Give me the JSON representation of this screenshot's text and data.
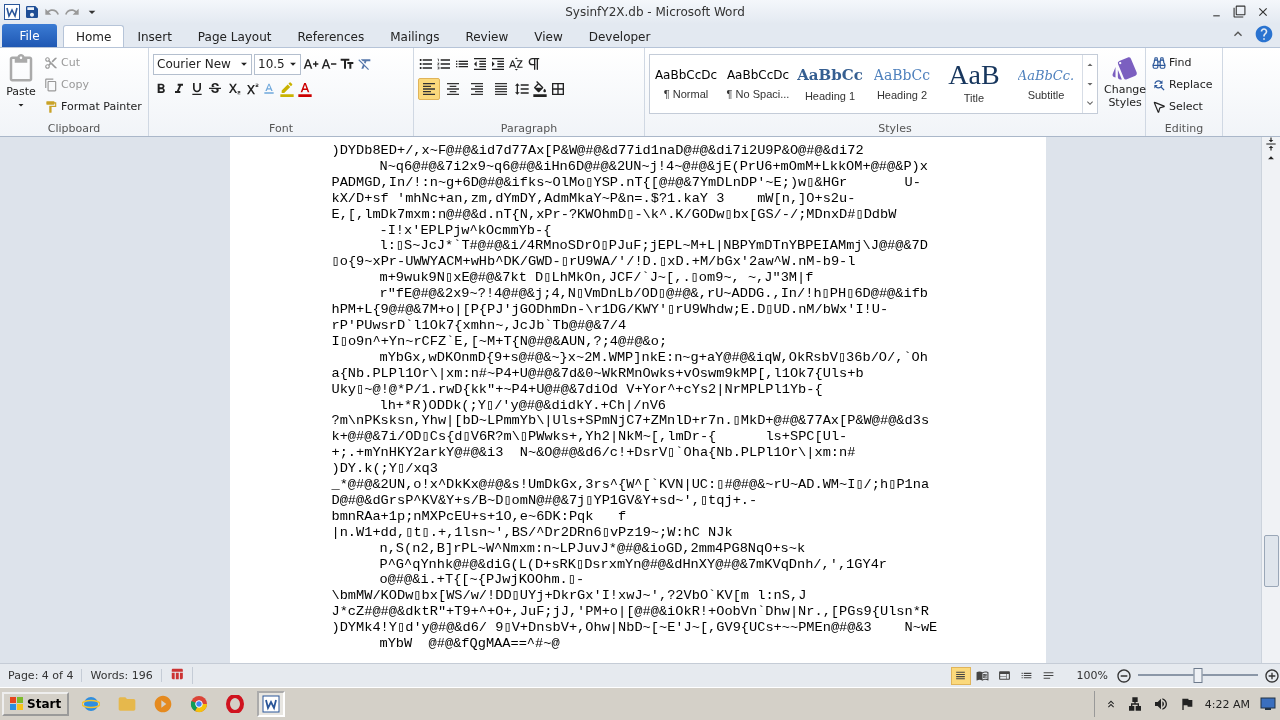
{
  "window": {
    "title": "SysinfY2X.db - Microsoft Word"
  },
  "file_tab": {
    "label": "File"
  },
  "tabs": [
    {
      "label": "Home",
      "selected": true
    },
    {
      "label": "Insert",
      "selected": false
    },
    {
      "label": "Page Layout",
      "selected": false
    },
    {
      "label": "References",
      "selected": false
    },
    {
      "label": "Mailings",
      "selected": false
    },
    {
      "label": "Review",
      "selected": false
    },
    {
      "label": "View",
      "selected": false
    },
    {
      "label": "Developer",
      "selected": false
    }
  ],
  "clipboard": {
    "label": "Clipboard",
    "paste": "Paste",
    "cut": {
      "label": "Cut",
      "disabled": true
    },
    "copy": {
      "label": "Copy",
      "disabled": true
    },
    "format_painter": "Format Painter"
  },
  "font": {
    "label": "Font",
    "font_name": "Courier New",
    "font_size": "10.5"
  },
  "paragraph": {
    "label": "Paragraph",
    "alignments": [
      {
        "kind": "left",
        "selected": true
      },
      {
        "kind": "center",
        "selected": false
      },
      {
        "kind": "right",
        "selected": false
      },
      {
        "kind": "justify",
        "selected": false
      }
    ]
  },
  "styles": {
    "label": "Styles",
    "items": [
      {
        "preview": "AaBbCcDc",
        "label": "¶ Normal",
        "kind": "normal"
      },
      {
        "preview": "AaBbCcDc",
        "label": "¶ No Spaci...",
        "kind": "normal"
      },
      {
        "preview": "AaBbCc",
        "label": "Heading 1",
        "kind": "heading1"
      },
      {
        "preview": "AaBbCc",
        "label": "Heading 2",
        "kind": "heading2"
      },
      {
        "preview": "AaB",
        "label": "Title",
        "kind": "title"
      },
      {
        "preview": "AaBbCc.",
        "label": "Subtitle",
        "kind": "subtitle"
      }
    ],
    "change_styles": [
      "Change",
      "Styles"
    ]
  },
  "editing": {
    "label": "Editing",
    "find": "Find",
    "replace": "Replace",
    "select": "Select"
  },
  "document": {
    "lines": [
      {
        "text": ")DYDb8ED+/,x~F@#@&id7d77Ax[P&W@#@&d77id1naD@#@&di7i2U9P&O@#@&di72",
        "indent": false
      },
      {
        "text": "N~q6@#@&7i2x9~q6@#@&iHn6D@#@&2UN~j!4~@#@&jE(PrU6+mOmM+LkkOM+@#@&P)x",
        "indent": true
      },
      {
        "text": "PADMGD,In/!:n~g+6D@#@&ifks~OlMo▯YSP.nT{[@#@&7YmDLnDP'~E;)w▯&HGr       U-",
        "indent": false
      },
      {
        "text": "kX/D+sf 'mhNc+an,zm,dYmDY,AdmMkaY~P&n=.$?1.kaY 3    mW[n,]O+s2u-",
        "indent": false
      },
      {
        "text": "E,[,lmDk7mxm:n@#@&d.nT{N,xPr-?KWOhmD▯-\\k^.K/GODw▯bx[GS/-/;MDnxD#▯DdbW",
        "indent": false
      },
      {
        "text": "-I!x'EPLPjw^kOcmmYb-{",
        "indent": true
      },
      {
        "text": "l:▯S~JcJ*`T#@#@&i/4RMnoSDrO▯PJuF;jEPL~M+L|NBPYmDTnYBPEIAMmj\\J@#@&7D",
        "indent": true
      },
      {
        "text": "▯o{9~xPr-UWWYACM+wHb^DK/GWD-▯rU9WA/'/!D.▯xD.+M/bGx'2aw^W.nM-b9-l",
        "indent": false
      },
      {
        "text": "m+9wuk9N▯xE@#@&7kt D▯LhMkOn,JCF/`J~[,.▯om9~, ~,J\"3M|f",
        "indent": true
      },
      {
        "text": "r\"fE@#@&2x9~?!4@#@&j;4,N▯VmDnLb/OD▯@#@&,rU~ADDG.,In/!h▯PH▯6D@#@&ifb",
        "indent": true
      },
      {
        "text": "hPM+L{9@#@&7M+o|[P{PJ'jGODhmDn-\\r1DG/KWY'▯rU9Whdw;E.D▯UD.nM/bWx'I!U-",
        "indent": false
      },
      {
        "text": "rP'PUwsrD`l1Ok7{xmhn~,JcJb`Tb@#@&7/4",
        "indent": false
      },
      {
        "text": "I▯o9n^+Yn~rCFZ`E,[~M+T{N@#@&AUN,?;4@#@&o;",
        "indent": false
      },
      {
        "text": "mYbGx,wDKOnmD{9+s@#@&~}x~2M.WMP]nkE:n~g+aY@#@&iqW,OkRsbV▯36b/O/,`Oh",
        "indent": true
      },
      {
        "text": "a{Nb.PLPl1Or\\|xm:n#~P4+U@#@&7d&0~WkRMnOwks+vOswm9kMP[,l1Ok7{Uls+b",
        "indent": false
      },
      {
        "text": "Uky▯~@!@*P/1.rwD{kk\"+~P4+U@#@&7diOd V+Yor^+cYs2|NrMPLPl1Yb-{",
        "indent": false
      },
      {
        "text": "lh+*R)ODDk(;Y▯/'y@#@&didkY.+Ch|/nV6",
        "indent": true
      },
      {
        "text": "?m\\nPKsksn,Yhw|[bD~LPmmYb\\|Uls+SPmNjC7+ZMnlD+r7n.▯MkD+@#@&77Ax[P&W@#@&d3s",
        "indent": false
      },
      {
        "text": "k+@#@&7i/OD▯Cs{d▯V6R?m\\▯PWwks+,Yh2|NkM~[,lmDr-{      ls+SPC[Ul-",
        "indent": false
      },
      {
        "text": "+;.+mYnHKY2arkY@#@&i3  N~&O@#@&d6/c!+DsrV▯`Oha{Nb.PLPl1Or\\|xm:n#",
        "indent": false
      },
      {
        "text": ")DY.k(;Y▯/xq3",
        "indent": false
      },
      {
        "text": "_*@#@&2UN,o!x^DkKx@#@&s!UmDkGx,3rs^{W^[`KVN|UC:▯#@#@&~rU~AD.WM~I▯/;h▯P1na",
        "indent": false
      },
      {
        "text": "D@#@&dGrsP^KV&Y+s/B~D▯omN@#@&7j▯YP1GV&Y+sd~',▯tqj+.-",
        "indent": false
      },
      {
        "text": "bmnRAa+1p;nMXPcEU+s+1O,e~6DK:Pqk   f",
        "indent": false
      },
      {
        "text": "|n.W1+dd,▯t▯.+,1lsn~',BS/^Dr2DRn6▯vPz19~;W:hC NJk",
        "indent": false
      },
      {
        "text": "n,S(n2,B]rPL~W^Nmxm:n~LPJuvJ*@#@&ioGD,2mm4PG8NqO+s~k",
        "indent": true
      },
      {
        "text": "P^G^qYnhk@#@&diG(L(D+sRK▯DsrxmYn@#@&dHnXY@#@&7mKVqDnh/,',1GY4r",
        "indent": true
      },
      {
        "text": "o@#@&i.+T{[~{PJwjKOOhm.▯-",
        "indent": true
      },
      {
        "text": "\\bmMW/KODw▯bx[WS/w/!DD▯UYj+DkrGx'I!xwJ~',?2VbO`KV[m l:nS,J",
        "indent": false
      },
      {
        "text": "J*cZ#@#@&dktR\"+T9+^+O+,JuF;jJ,'PM+o|[@#@&iOkR!+OobVn`Dhw|Nr.,[PGs9{Ulsn*R",
        "indent": false
      },
      {
        "text": ")DYMk4!Y▯d'y@#@&d6/ 9▯V+DnsbV+,Ohw|NbD~[~E'J~[,GV9{UCs+~~PMEn@#@&3    N~wE",
        "indent": false
      },
      {
        "text": "mYbW  @#@&fQgMAA==^#~@",
        "indent": true
      }
    ]
  },
  "status_bar": {
    "page": "Page: 4 of 4",
    "words": "Words: 196",
    "views": [
      {
        "selected": true
      },
      {
        "selected": false
      },
      {
        "selected": false
      },
      {
        "selected": false
      },
      {
        "selected": false
      }
    ],
    "zoom": "100%",
    "zoom_level": {
      "level": 0.5
    }
  },
  "taskbar": {
    "start": "Start",
    "apps": [
      {
        "kind": "ie",
        "active": false
      },
      {
        "kind": "folder",
        "active": false
      },
      {
        "kind": "media",
        "active": false
      },
      {
        "kind": "chrome",
        "active": false
      },
      {
        "kind": "opera",
        "active": false
      },
      {
        "kind": "word",
        "active": true
      }
    ],
    "clock": "4:22 AM"
  }
}
